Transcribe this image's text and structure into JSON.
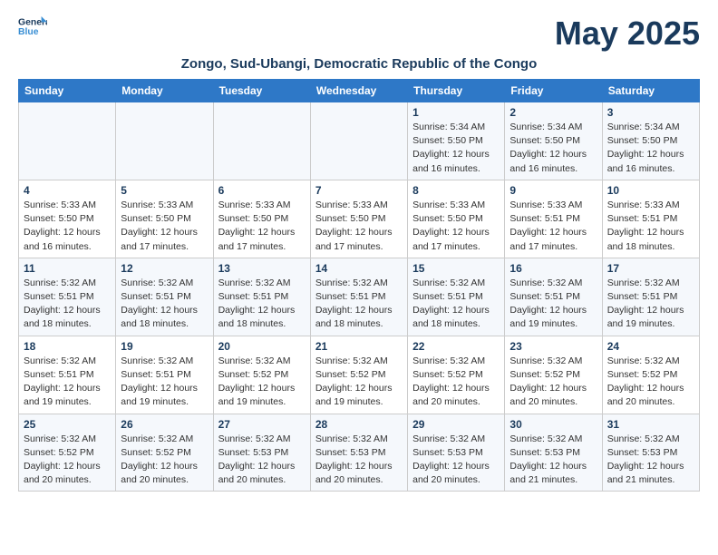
{
  "logo": {
    "line1": "General",
    "line2": "Blue"
  },
  "title": "May 2025",
  "subtitle": "Zongo, Sud-Ubangi, Democratic Republic of the Congo",
  "weekdays": [
    "Sunday",
    "Monday",
    "Tuesday",
    "Wednesday",
    "Thursday",
    "Friday",
    "Saturday"
  ],
  "weeks": [
    [
      {
        "day": "",
        "info": ""
      },
      {
        "day": "",
        "info": ""
      },
      {
        "day": "",
        "info": ""
      },
      {
        "day": "",
        "info": ""
      },
      {
        "day": "1",
        "info": "Sunrise: 5:34 AM\nSunset: 5:50 PM\nDaylight: 12 hours\nand 16 minutes."
      },
      {
        "day": "2",
        "info": "Sunrise: 5:34 AM\nSunset: 5:50 PM\nDaylight: 12 hours\nand 16 minutes."
      },
      {
        "day": "3",
        "info": "Sunrise: 5:34 AM\nSunset: 5:50 PM\nDaylight: 12 hours\nand 16 minutes."
      }
    ],
    [
      {
        "day": "4",
        "info": "Sunrise: 5:33 AM\nSunset: 5:50 PM\nDaylight: 12 hours\nand 16 minutes."
      },
      {
        "day": "5",
        "info": "Sunrise: 5:33 AM\nSunset: 5:50 PM\nDaylight: 12 hours\nand 17 minutes."
      },
      {
        "day": "6",
        "info": "Sunrise: 5:33 AM\nSunset: 5:50 PM\nDaylight: 12 hours\nand 17 minutes."
      },
      {
        "day": "7",
        "info": "Sunrise: 5:33 AM\nSunset: 5:50 PM\nDaylight: 12 hours\nand 17 minutes."
      },
      {
        "day": "8",
        "info": "Sunrise: 5:33 AM\nSunset: 5:50 PM\nDaylight: 12 hours\nand 17 minutes."
      },
      {
        "day": "9",
        "info": "Sunrise: 5:33 AM\nSunset: 5:51 PM\nDaylight: 12 hours\nand 17 minutes."
      },
      {
        "day": "10",
        "info": "Sunrise: 5:33 AM\nSunset: 5:51 PM\nDaylight: 12 hours\nand 18 minutes."
      }
    ],
    [
      {
        "day": "11",
        "info": "Sunrise: 5:32 AM\nSunset: 5:51 PM\nDaylight: 12 hours\nand 18 minutes."
      },
      {
        "day": "12",
        "info": "Sunrise: 5:32 AM\nSunset: 5:51 PM\nDaylight: 12 hours\nand 18 minutes."
      },
      {
        "day": "13",
        "info": "Sunrise: 5:32 AM\nSunset: 5:51 PM\nDaylight: 12 hours\nand 18 minutes."
      },
      {
        "day": "14",
        "info": "Sunrise: 5:32 AM\nSunset: 5:51 PM\nDaylight: 12 hours\nand 18 minutes."
      },
      {
        "day": "15",
        "info": "Sunrise: 5:32 AM\nSunset: 5:51 PM\nDaylight: 12 hours\nand 18 minutes."
      },
      {
        "day": "16",
        "info": "Sunrise: 5:32 AM\nSunset: 5:51 PM\nDaylight: 12 hours\nand 19 minutes."
      },
      {
        "day": "17",
        "info": "Sunrise: 5:32 AM\nSunset: 5:51 PM\nDaylight: 12 hours\nand 19 minutes."
      }
    ],
    [
      {
        "day": "18",
        "info": "Sunrise: 5:32 AM\nSunset: 5:51 PM\nDaylight: 12 hours\nand 19 minutes."
      },
      {
        "day": "19",
        "info": "Sunrise: 5:32 AM\nSunset: 5:51 PM\nDaylight: 12 hours\nand 19 minutes."
      },
      {
        "day": "20",
        "info": "Sunrise: 5:32 AM\nSunset: 5:52 PM\nDaylight: 12 hours\nand 19 minutes."
      },
      {
        "day": "21",
        "info": "Sunrise: 5:32 AM\nSunset: 5:52 PM\nDaylight: 12 hours\nand 19 minutes."
      },
      {
        "day": "22",
        "info": "Sunrise: 5:32 AM\nSunset: 5:52 PM\nDaylight: 12 hours\nand 20 minutes."
      },
      {
        "day": "23",
        "info": "Sunrise: 5:32 AM\nSunset: 5:52 PM\nDaylight: 12 hours\nand 20 minutes."
      },
      {
        "day": "24",
        "info": "Sunrise: 5:32 AM\nSunset: 5:52 PM\nDaylight: 12 hours\nand 20 minutes."
      }
    ],
    [
      {
        "day": "25",
        "info": "Sunrise: 5:32 AM\nSunset: 5:52 PM\nDaylight: 12 hours\nand 20 minutes."
      },
      {
        "day": "26",
        "info": "Sunrise: 5:32 AM\nSunset: 5:52 PM\nDaylight: 12 hours\nand 20 minutes."
      },
      {
        "day": "27",
        "info": "Sunrise: 5:32 AM\nSunset: 5:53 PM\nDaylight: 12 hours\nand 20 minutes."
      },
      {
        "day": "28",
        "info": "Sunrise: 5:32 AM\nSunset: 5:53 PM\nDaylight: 12 hours\nand 20 minutes."
      },
      {
        "day": "29",
        "info": "Sunrise: 5:32 AM\nSunset: 5:53 PM\nDaylight: 12 hours\nand 20 minutes."
      },
      {
        "day": "30",
        "info": "Sunrise: 5:32 AM\nSunset: 5:53 PM\nDaylight: 12 hours\nand 21 minutes."
      },
      {
        "day": "31",
        "info": "Sunrise: 5:32 AM\nSunset: 5:53 PM\nDaylight: 12 hours\nand 21 minutes."
      }
    ]
  ]
}
